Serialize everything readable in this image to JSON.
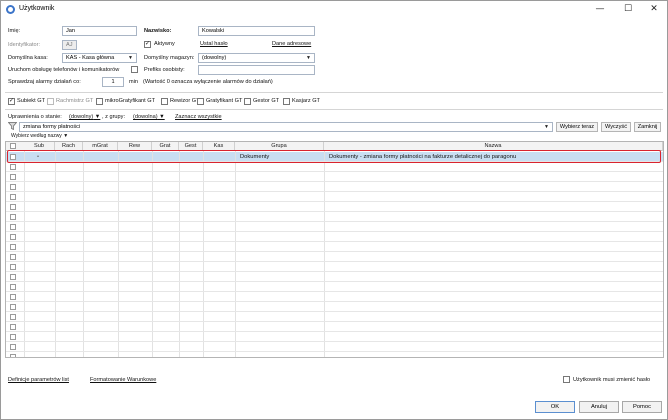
{
  "window": {
    "title": "Użytkownik"
  },
  "form": {
    "imie_label": "Imię:",
    "imie_value": "Jan",
    "identyfikator_label": "Identyfikator:",
    "identyfikator_value": "AJ",
    "domyslna_kasa_label": "Domyślna kasa:",
    "domyslna_kasa_value": "KAS - Kasa główna",
    "telefony_label": "Uruchom obsługę telefonów i komunikatorów",
    "sprawdzaj_label": "Sprawdzaj alarmy działań co:",
    "sprawdzaj_value": "1",
    "min_label": "min",
    "alarm_note": "(Wartość 0 oznacza wyłączenie alarmów do działań)",
    "nazwisko_label": "Nazwisko:",
    "nazwisko_value": "Kowalski",
    "aktywny_label": "Aktywny",
    "ustal_haslo_link": "Ustal hasło",
    "dane_adresowe_link": "Dane adresowe",
    "magazyn_label": "Domyślny magazyn:",
    "magazyn_value": "(dowolny)",
    "prefiks_label": "Prefiks osobisty:",
    "prefiks_value": ""
  },
  "modules": [
    {
      "label": "Subiekt GT",
      "checked": true,
      "disabled": false
    },
    {
      "label": "Rachmistrz GT",
      "checked": false,
      "disabled": true
    },
    {
      "label": "mikroGratyfikant GT",
      "checked": false,
      "disabled": false
    },
    {
      "label": "Rewizor GT",
      "checked": false,
      "disabled": false
    },
    {
      "label": "Gratyfikant GT",
      "checked": false,
      "disabled": false
    },
    {
      "label": "Gestor GT",
      "checked": false,
      "disabled": false
    },
    {
      "label": "Kasjarz GT",
      "checked": false,
      "disabled": false
    }
  ],
  "filters": {
    "uprawnienia_label": "Uprawnienia o stanie:",
    "stan_value": "(dowolny)",
    "z_grupy_label": ", z grupy:",
    "grupa_value": "(dowolna)",
    "zaznacz_link": "Zaznacz wszystkie",
    "search_value": "zmiana formy płatności",
    "search_mode": "Wybierz według nazwy",
    "wybierz_teraz": "Wybierz teraz",
    "wyczysc": "Wyczyść",
    "zamknij": "Zamknij"
  },
  "grid": {
    "columns": [
      "Sub",
      "Rach",
      "mGrat",
      "Rew",
      "Grat",
      "Gest",
      "Kas",
      "Grupa",
      "Nazwa"
    ],
    "rows": [
      {
        "sub": "•",
        "grupa": "Dokumenty",
        "nazwa": "Dokumenty - zmiana formy płatności na fakturze detalicznej do paragonu",
        "selected": true
      }
    ],
    "empty_rows": 20
  },
  "footer": {
    "definicje_link": "Definicje parametrów list",
    "formatowanie_link": "Formatowanie Warunkowe",
    "zmiana_hasla_label": "Użytkownik musi zmienić hasło",
    "ok": "OK",
    "anuluj": "Anuluj",
    "pomoc": "Pomoc"
  },
  "colors": {
    "selection": "#c9def2",
    "highlight_frame": "#d9242f"
  }
}
